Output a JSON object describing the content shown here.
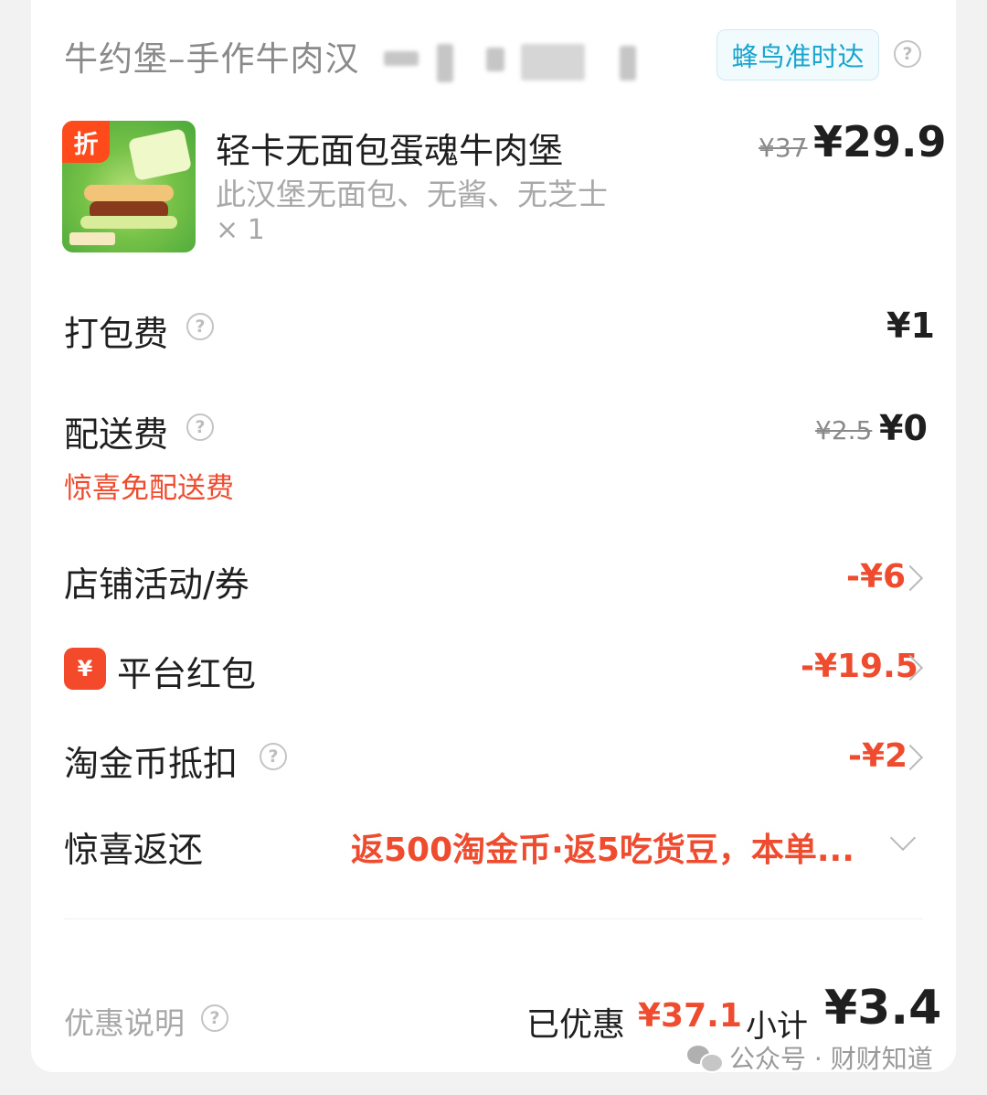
{
  "header": {
    "shop_name": "牛约堡–手作牛肉汉",
    "delivery_badge": "蜂鸟准时达"
  },
  "product": {
    "thumb_tag": "折",
    "title": "轻卡无面包蛋魂牛肉堡",
    "description": "此汉堡无面包、无酱、无芝士",
    "quantity": "× 1",
    "original_price": "¥37",
    "price": "¥29.9"
  },
  "rows": {
    "packing": {
      "label": "打包费",
      "value": "¥1"
    },
    "delivery": {
      "label": "配送费",
      "original": "¥2.5",
      "value": "¥0",
      "note": "惊喜免配送费"
    },
    "store_promo": {
      "label": "店铺活动/券",
      "value": "-¥6"
    },
    "red_packet": {
      "icon": "¥",
      "label": "平台红包",
      "value": "-¥19.5"
    },
    "coins": {
      "label": "淘金币抵扣",
      "value": "-¥2"
    },
    "surprise": {
      "label": "惊喜返还",
      "value": "返500淘金币·返5吃货豆，本单..."
    }
  },
  "footer": {
    "note": "优惠说明",
    "saved_label": "已优惠",
    "saved_value": "¥37.1",
    "subtotal_label": "小计",
    "subtotal_value": "¥3.4"
  },
  "watermark": "公众号 · 财财知道",
  "colors": {
    "accent_red": "#ee4b2f",
    "badge_blue": "#1aa5cf",
    "text_gray": "#a8a8a8"
  },
  "icons": [
    "help-circle-icon",
    "chevron-right-icon",
    "chevron-down-icon",
    "red-packet-icon",
    "wechat-icon"
  ]
}
